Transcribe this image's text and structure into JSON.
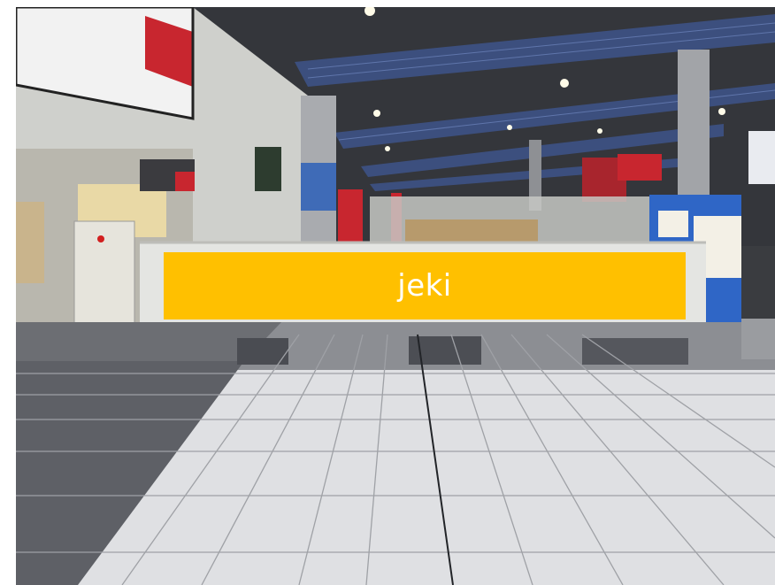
{
  "image": {
    "subject": "station-concourse-photo",
    "colors": {
      "banner": "#ffc000",
      "banner_text": "#ffffff",
      "floor_light": "#dfe0e3",
      "floor_dark": "#5e6066",
      "ceiling": "#34363b",
      "pillar_band": "#3f6bb7",
      "sign_red": "#c8262f",
      "atm_blue": "#2f66c6"
    },
    "icons": [
      "ceiling-light-icon",
      "signboard-icon"
    ]
  },
  "banner": {
    "text": "jeki"
  }
}
